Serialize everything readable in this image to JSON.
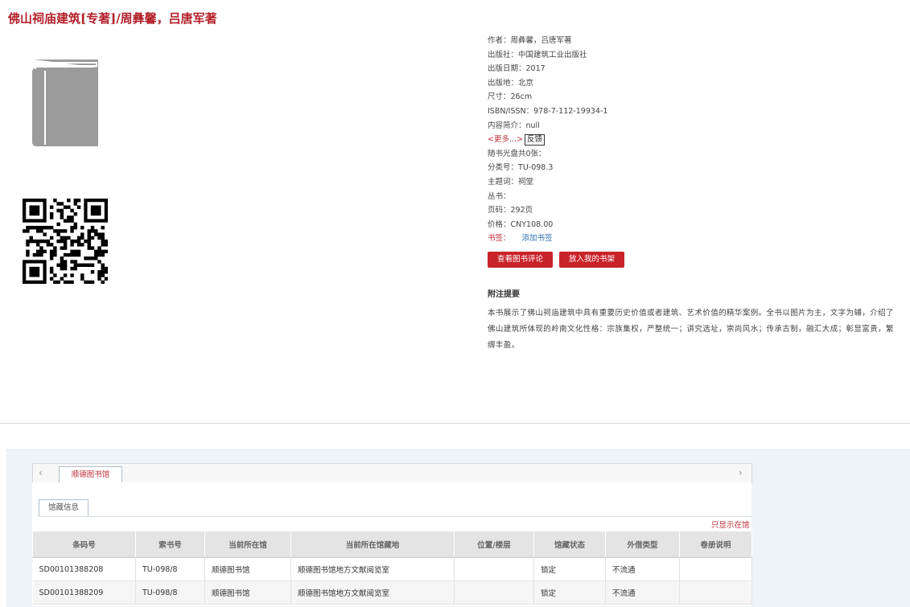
{
  "title": "佛山祠庙建筑[专著]/周彝馨，吕唐军著",
  "metadata": [
    {
      "label": "作者：",
      "value": "周彝馨，吕唐军著"
    },
    {
      "label": "出版社：",
      "value": "中国建筑工业出版社"
    },
    {
      "label": "出版日期：",
      "value": "2017"
    },
    {
      "label": "出版地：",
      "value": "北京"
    },
    {
      "label": "尺寸：",
      "value": "26cm"
    },
    {
      "label": "ISBN/ISSN：",
      "value": "978-7-112-19934-1"
    },
    {
      "label": "内容简介：",
      "value": "null"
    }
  ],
  "more_link": "<更多...>",
  "feedback_label": "反馈",
  "metadata2": [
    {
      "label": "随书光盘共0张：",
      "value": ""
    },
    {
      "label": "分类号：",
      "value": "TU-098.3"
    },
    {
      "label": "主题词：",
      "value": "祠堂"
    },
    {
      "label": "丛书：",
      "value": ""
    },
    {
      "label": "页码：",
      "value": "292页"
    },
    {
      "label": "价格：",
      "value": "CNY108.00"
    }
  ],
  "tags": {
    "label": "书签：",
    "action": "添加书签"
  },
  "buttons": {
    "review": "查看图书评论",
    "shelf": "放入我的书架"
  },
  "abstract": {
    "heading": "附注提要",
    "text": "本书展示了佛山祠庙建筑中具有重要历史价值或者建筑、艺术价值的精华案例。全书以图片为主，文字为辅，介绍了佛山建筑所体现的岭南文化性格：宗族集权，严整统一；讲究选址，崇尚风水；传承古制，融汇大成；彰显富贵，繁缛丰盈。"
  },
  "holdings": {
    "nav_prev": "‹",
    "nav_next": "›",
    "library_tab": "顺德图书馆",
    "subtab": "馆藏信息",
    "only_readable": "只显示在馆",
    "columns": [
      "条码号",
      "索书号",
      "当前所在馆",
      "当前所在馆藏地",
      "位置/楼层",
      "馆藏状态",
      "外借类型",
      "卷册说明"
    ],
    "rows": [
      [
        "SD00101388208",
        "TU-098/8",
        "顺德图书馆",
        "顺德图书馆地方文献阅览室",
        "",
        "锁定",
        "不流通",
        ""
      ],
      [
        "SD00101388209",
        "TU-098/8",
        "顺德图书馆",
        "顺德图书馆地方文献阅览室",
        "",
        "锁定",
        "不流通",
        ""
      ]
    ]
  },
  "colors": {
    "brand_red": "#c9232a",
    "link_blue": "#2d6fb3",
    "cover_gray": "#9b9b9b"
  },
  "icons": {
    "cover": "book-cover-icon",
    "qr": "qr-code-icon"
  }
}
